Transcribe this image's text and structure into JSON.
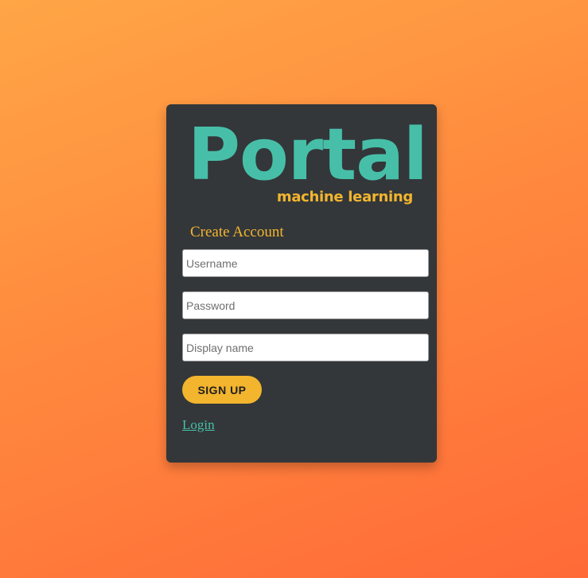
{
  "logo": {
    "title": "Portal",
    "subtitle": "machine learning"
  },
  "form": {
    "heading": "Create Account",
    "username_placeholder": "Username",
    "password_placeholder": "Password",
    "display_name_placeholder": "Display name",
    "submit_label": "SIGN UP",
    "login_link": "Login"
  },
  "colors": {
    "card_background": "#33373a",
    "logo_teal": "#47bfa8",
    "accent_yellow": "#f3b52e",
    "background_gradient_start": "#ffa646",
    "background_gradient_end": "#ff6a38"
  }
}
